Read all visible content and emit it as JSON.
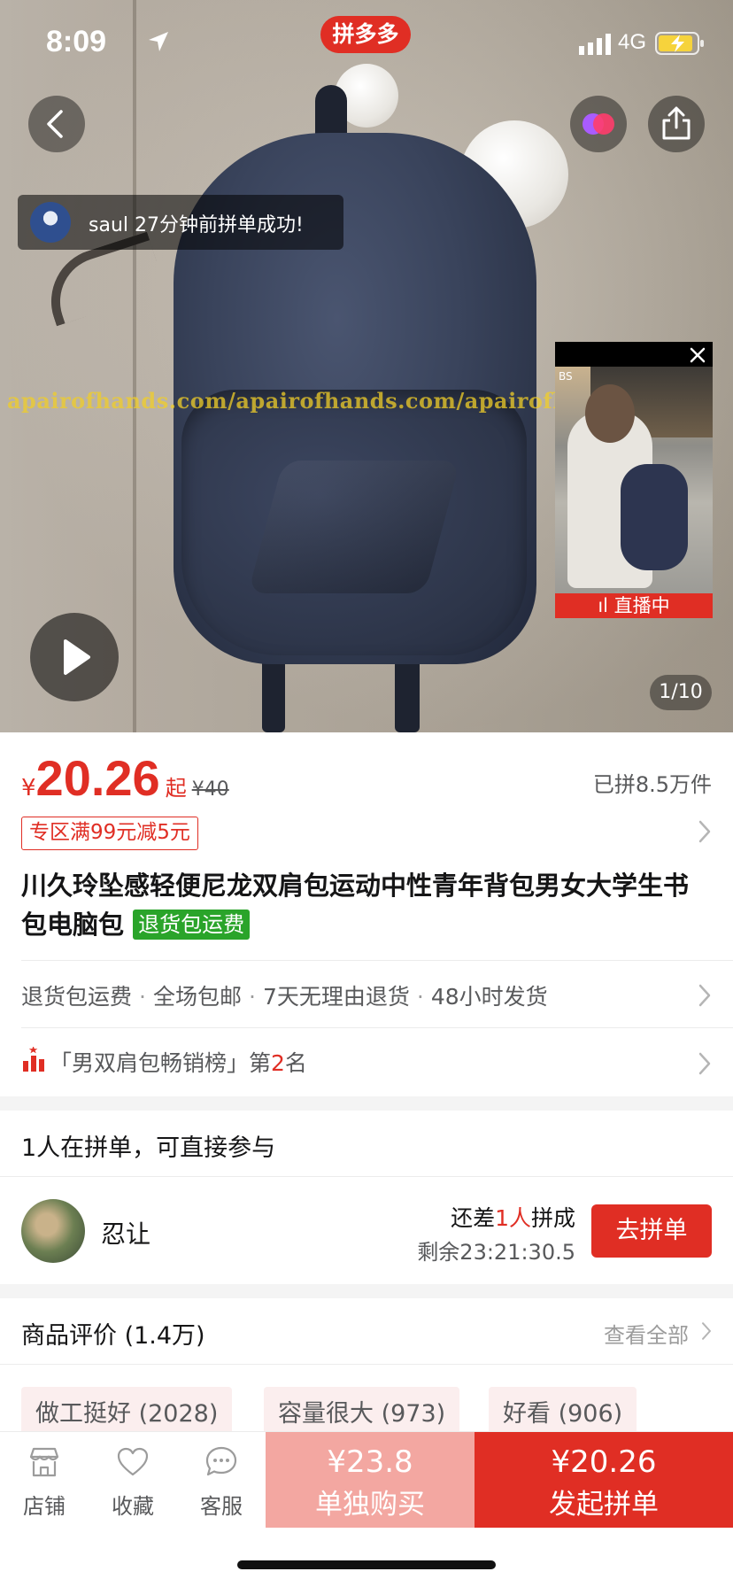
{
  "status_bar": {
    "time": "8:09",
    "brand": "拼多多",
    "network": "4G"
  },
  "hero": {
    "watermark": "apairofhands.com/apairofhands.com/apairofhands.com",
    "toast_text": "saul 27分钟前拼单成功!",
    "live_badge": "直播中",
    "live_corner_text": "BS",
    "image_counter": "1/10"
  },
  "product": {
    "currency": "¥",
    "price": "20.26",
    "price_suffix": "起",
    "original_price": "¥40",
    "sold_count": "已拼8.5万件",
    "promo_label": "专区满99元减5元",
    "title": "川久玲坠感轻便尼龙双肩包运动中性青年背包男女大学生书包电脑包",
    "title_tag": "退货包运费",
    "services": [
      "退货包运费",
      "全场包邮",
      "7天无理由退货",
      "48小时发货"
    ],
    "rank": {
      "prefix": "「男双肩包畅销榜」第",
      "number": "2",
      "suffix": "名"
    }
  },
  "group_buy": {
    "title": "1人在拼单，可直接参与",
    "member_name": "忍让",
    "need_prefix": "还差",
    "need_count": "1人",
    "need_suffix": "拼成",
    "remaining": "剩余23:21:30.5",
    "join_label": "去拼单"
  },
  "reviews": {
    "title": "商品评价 (1.4万)",
    "view_all": "查看全部",
    "chips": [
      "做工挺好 (2028)",
      "容量很大 (973)",
      "好看 (906)"
    ]
  },
  "bottom_bar": {
    "tabs": [
      {
        "label": "店铺",
        "icon": "store-icon"
      },
      {
        "label": "收藏",
        "icon": "heart-icon"
      },
      {
        "label": "客服",
        "icon": "chat-icon"
      }
    ],
    "buy_alone_price": "¥23.8",
    "buy_alone_label": "单独购买",
    "buy_group_price": "¥20.26",
    "buy_group_label": "发起拼单"
  },
  "colors": {
    "accent": "#e02e24",
    "accent_light": "#f3a7a1",
    "green_tag": "#2aa42a"
  }
}
